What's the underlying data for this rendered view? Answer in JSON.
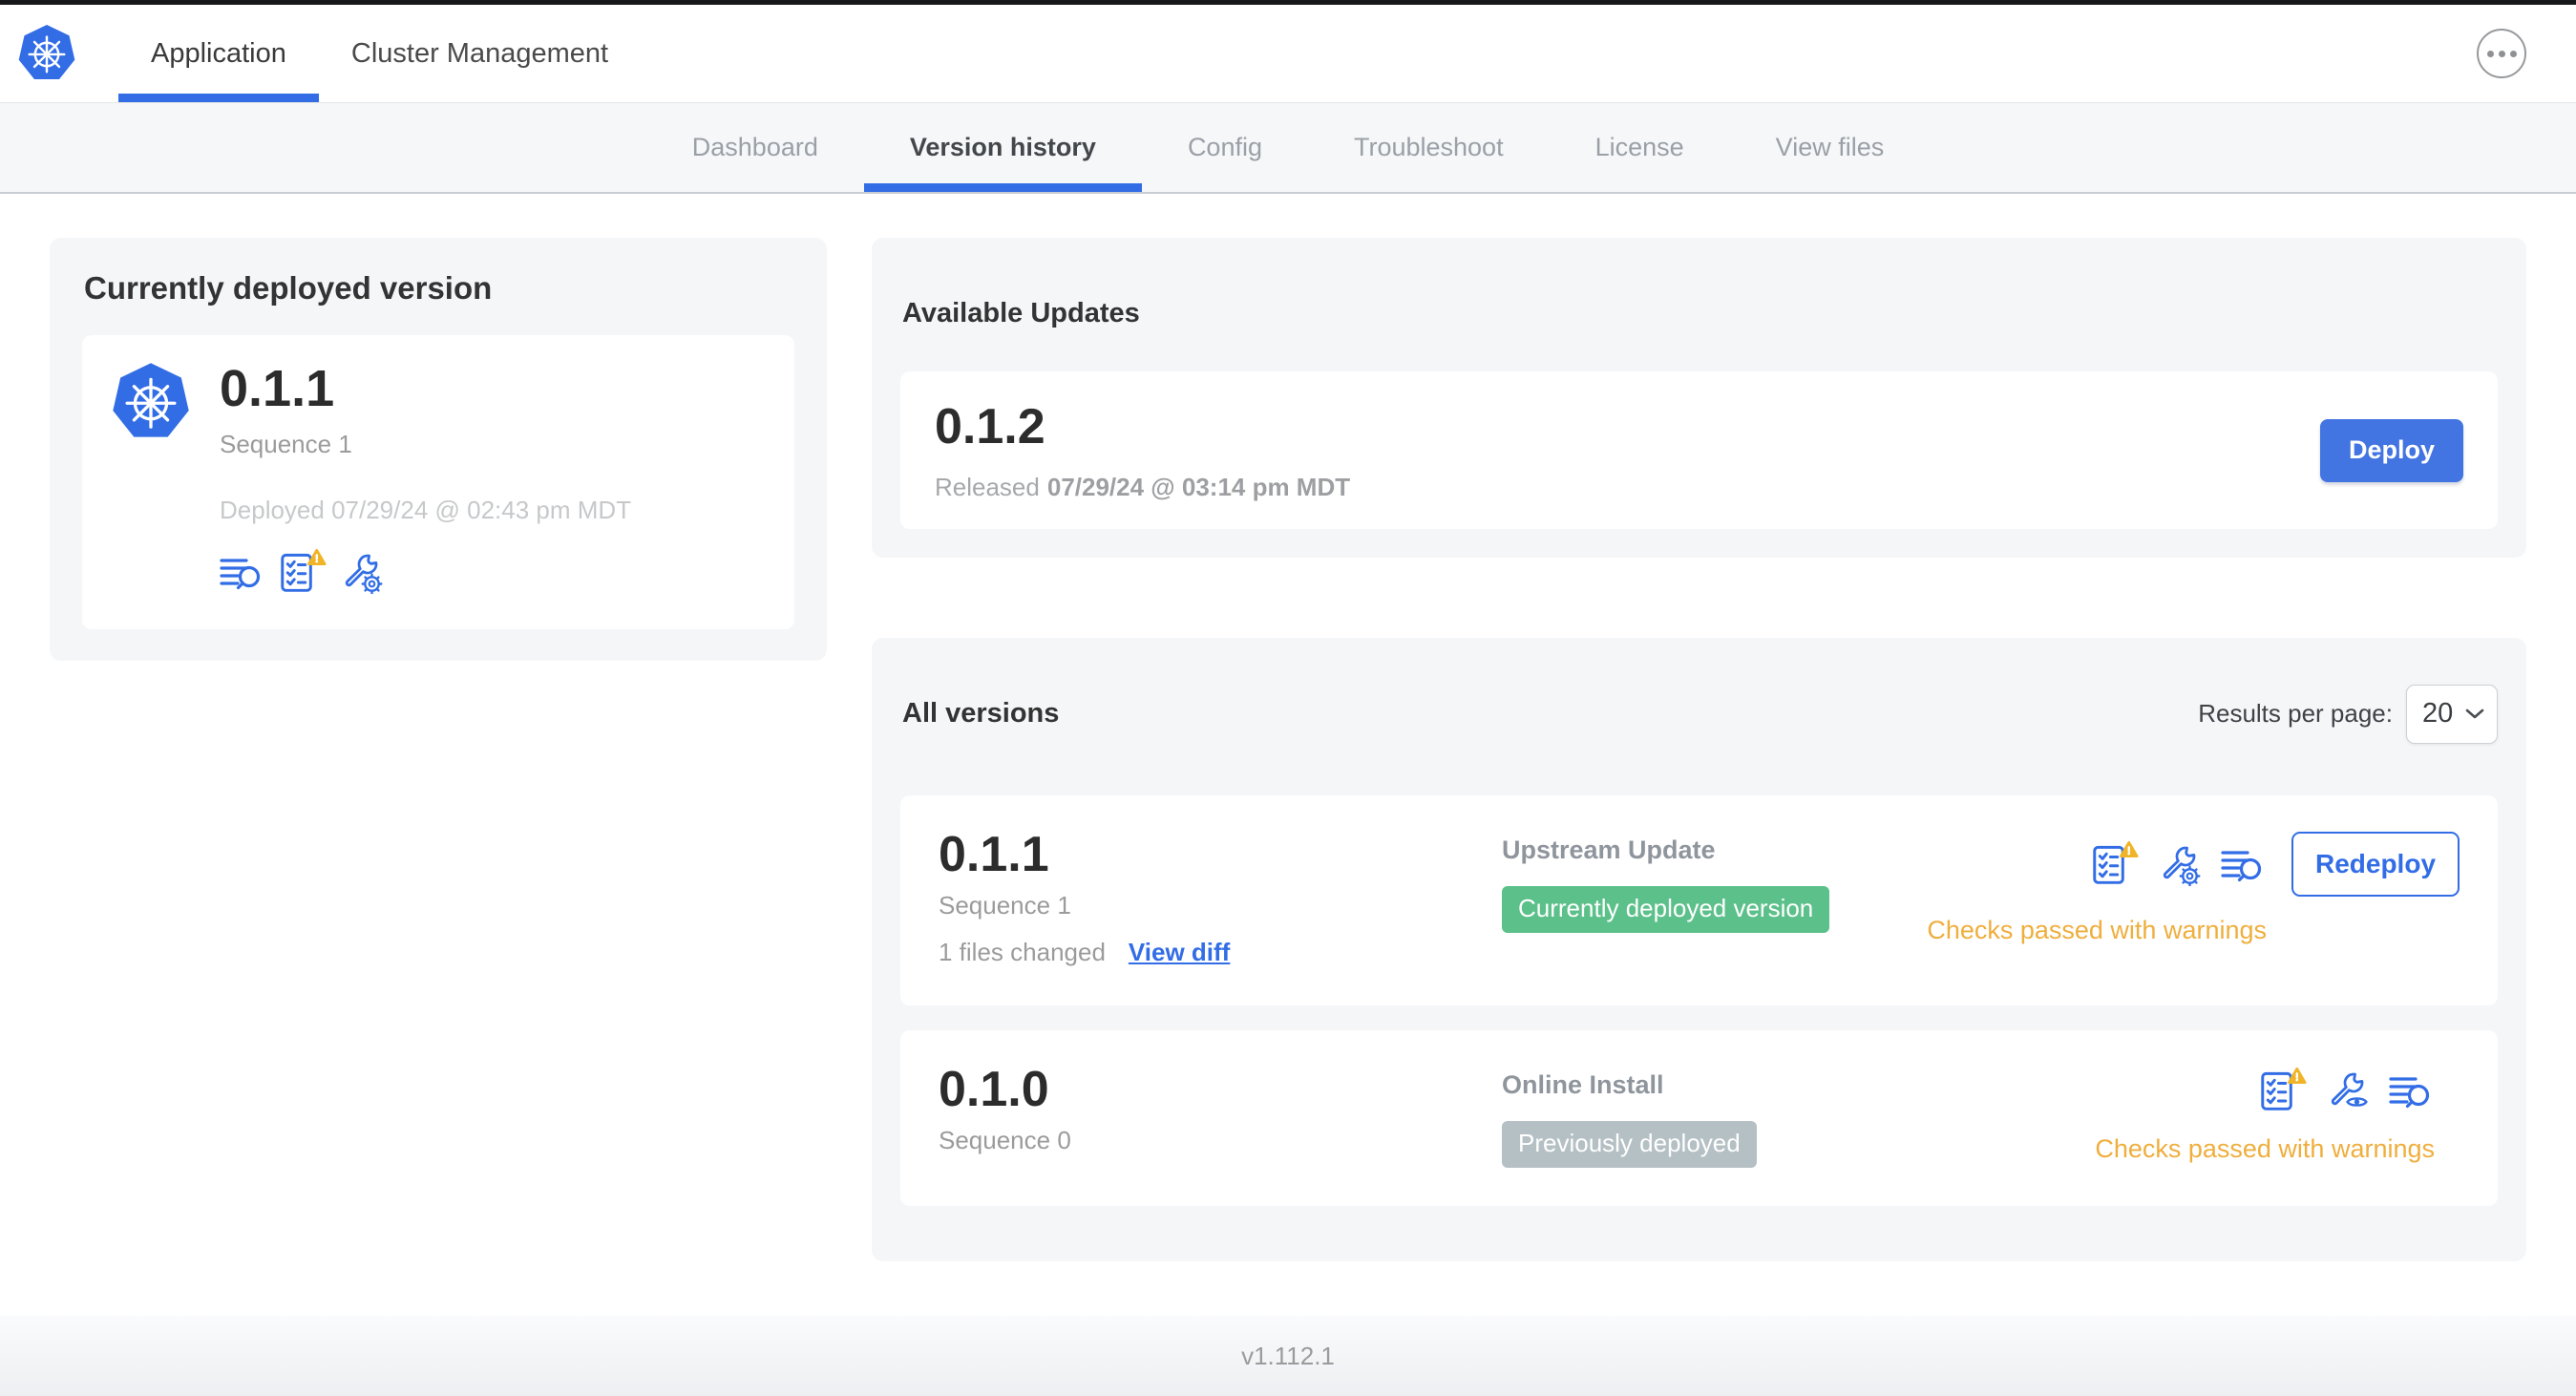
{
  "colors": {
    "accent_blue": "#326de6",
    "button_blue": "#4274e2",
    "warning_orange": "#efae3d",
    "warning_triangle": "#f0b429",
    "badge_green": "#5cc08a",
    "badge_gray": "#b5c0c4",
    "card_gray": "#f5f6f8"
  },
  "icons": {
    "logo": "kubernetes-wheel",
    "more": "ellipsis",
    "diff": "lines-magnifier",
    "preflight": "checklist-with-warning-triangle",
    "edit_config": "wrench-gear",
    "view_config": "wrench-eye",
    "select_chevron": "chevron-down"
  },
  "header": {
    "tabs": [
      {
        "label": "Application",
        "active": true
      },
      {
        "label": "Cluster Management",
        "active": false
      }
    ]
  },
  "subnav": {
    "items": [
      {
        "label": "Dashboard",
        "active": false
      },
      {
        "label": "Version history",
        "active": true
      },
      {
        "label": "Config",
        "active": false
      },
      {
        "label": "Troubleshoot",
        "active": false
      },
      {
        "label": "License",
        "active": false
      },
      {
        "label": "View files",
        "active": false
      }
    ]
  },
  "current_version": {
    "title": "Currently deployed version",
    "version": "0.1.1",
    "sequence": "Sequence 1",
    "deployed_at": "Deployed 07/29/24 @ 02:43 pm MDT",
    "icons": [
      "diff-icon",
      "preflight-checks-warning-icon",
      "edit-config-icon"
    ]
  },
  "available_updates": {
    "title": "Available Updates",
    "update": {
      "version": "0.1.2",
      "released_label": "Released",
      "released_date": "07/29/24 @ 03:14 pm MDT",
      "deploy_label": "Deploy"
    }
  },
  "all_versions": {
    "title": "All versions",
    "results_per_page_label": "Results per page:",
    "results_per_page_value": "20",
    "rows": [
      {
        "version": "0.1.1",
        "sequence": "Sequence 1",
        "files_changed": "1 files changed",
        "view_diff_label": "View diff",
        "source": "Upstream Update",
        "badge": "Currently deployed version",
        "badge_style": "green",
        "status": "Checks passed with warnings",
        "action_label": "Redeploy",
        "icons": [
          "preflight-checks-warning-icon",
          "edit-config-icon",
          "diff-icon"
        ]
      },
      {
        "version": "0.1.0",
        "sequence": "Sequence 0",
        "source": "Online Install",
        "badge": "Previously deployed",
        "badge_style": "gray",
        "status": "Checks passed with warnings",
        "icons": [
          "preflight-checks-warning-icon",
          "view-config-icon",
          "diff-icon"
        ]
      }
    ]
  },
  "footer": {
    "app_version": "v1.112.1"
  }
}
